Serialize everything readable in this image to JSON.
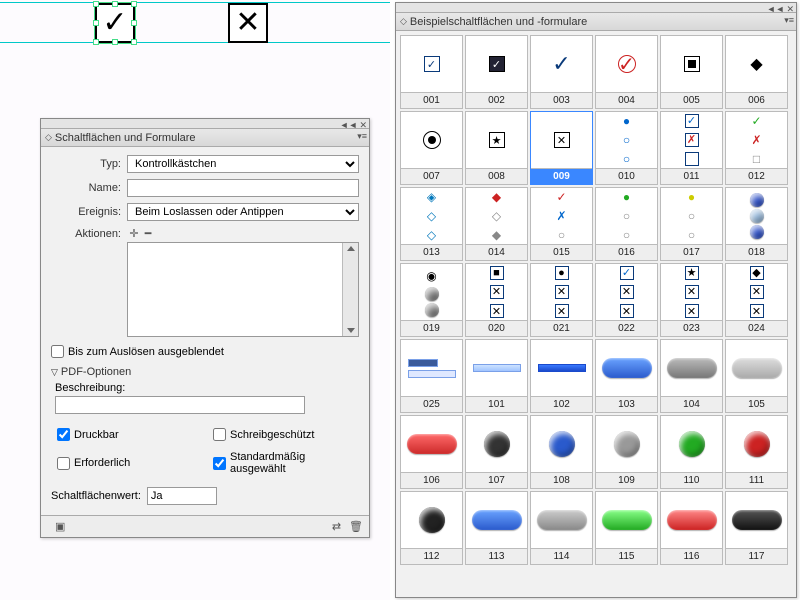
{
  "form_panel": {
    "title": "Schaltflächen und Formulare",
    "labels": {
      "typ": "Typ:",
      "name": "Name:",
      "ereignis": "Ereignis:",
      "aktionen": "Aktionen:",
      "bis_ausgeblendet": "Bis zum Auslösen ausgeblendet",
      "pdf_optionen": "PDF-Optionen",
      "beschreibung": "Beschreibung:",
      "druckbar": "Druckbar",
      "schreibgeschuetzt": "Schreibgeschützt",
      "erforderlich": "Erforderlich",
      "standard_ausgewaehlt": "Standardmäßig ausgewählt",
      "schaltflaechenwert": "Schaltflächenwert:"
    },
    "values": {
      "typ": "Kontrollkästchen",
      "name": "",
      "ereignis": "Beim Loslassen oder Antippen",
      "beschreibung": "",
      "schaltflaechenwert": "Ja",
      "druckbar": true,
      "schreibgeschuetzt": false,
      "erforderlich": false,
      "standard_ausgewaehlt": true,
      "bis_ausgeblendet": false
    }
  },
  "library_panel": {
    "title": "Beispielschaltflächen und -formulare",
    "selected": "009",
    "cells": [
      "001",
      "002",
      "003",
      "004",
      "005",
      "006",
      "007",
      "008",
      "009",
      "010",
      "011",
      "012",
      "013",
      "014",
      "015",
      "016",
      "017",
      "018",
      "019",
      "020",
      "021",
      "022",
      "023",
      "024",
      "025",
      "101",
      "102",
      "103",
      "104",
      "105",
      "106",
      "107",
      "108",
      "109",
      "110",
      "111",
      "112",
      "113",
      "114",
      "115",
      "116",
      "117"
    ]
  }
}
